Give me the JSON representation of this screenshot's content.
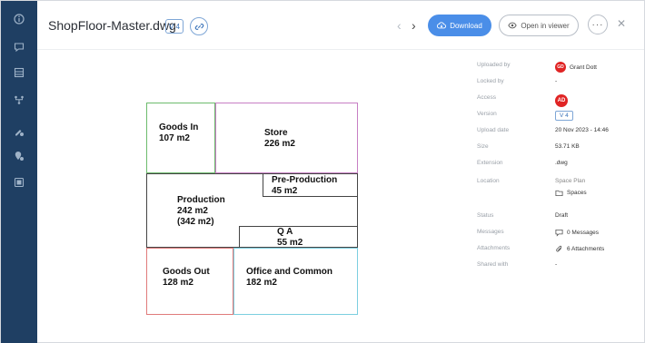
{
  "header": {
    "file_name": "ShopFloor-Master.dwg",
    "version_badge": "V 4",
    "prev_arrow": "‹",
    "next_arrow": "›",
    "download_label": "Download",
    "open_viewer_label": "Open in viewer",
    "more_label": "···",
    "close_label": "✕"
  },
  "rail": {
    "icons": [
      "info-icon",
      "comment-icon",
      "table-icon",
      "workflow-icon",
      "edit-settings-icon",
      "location-settings-icon",
      "grid-icon"
    ]
  },
  "floor_plan": {
    "rooms": [
      {
        "name": "Goods In",
        "area": "107 m2",
        "color": "#6dbb6d"
      },
      {
        "name": "Store",
        "area": "226 m2",
        "color": "#c77fc4"
      },
      {
        "name": "Pre-Production",
        "area": "45 m2",
        "color": "#444444"
      },
      {
        "name": "Production",
        "area": "242 m2",
        "extra": "(342 m2)",
        "color": "#444444"
      },
      {
        "name": "Q A",
        "area": "55 m2",
        "color": "#444444"
      },
      {
        "name": "Goods Out",
        "area": "128 m2",
        "color": "#e07b7b"
      },
      {
        "name": "Office and Common",
        "area": "182 m2",
        "color": "#7ccfe0"
      }
    ]
  },
  "details": {
    "uploaded_by": {
      "label": "Uploaded by",
      "avatar": "GD",
      "value": "Grant Dott"
    },
    "locked_by": {
      "label": "Locked by",
      "value": "-"
    },
    "access": {
      "label": "Access",
      "avatar": "AD"
    },
    "version": {
      "label": "Version",
      "value": "V 4"
    },
    "upload_date": {
      "label": "Upload date",
      "value": "20 Nov 2023 - 14:46"
    },
    "size": {
      "label": "Size",
      "value": "53.71 KB"
    },
    "extension": {
      "label": "Extension",
      "value": ".dwg"
    },
    "location": {
      "label": "Location",
      "value": "Space Plan",
      "sub_value": "Spaces"
    },
    "status": {
      "label": "Status",
      "value": "Draft"
    },
    "messages": {
      "label": "Messages",
      "value": "0 Messages"
    },
    "attachments": {
      "label": "Attachments",
      "value": "6 Attachments"
    },
    "shared_with": {
      "label": "Shared with",
      "value": "-"
    }
  },
  "colors": {
    "rail_bg": "#1f3f63",
    "accent": "#4a8ee8",
    "avatar_red": "#e02424"
  }
}
